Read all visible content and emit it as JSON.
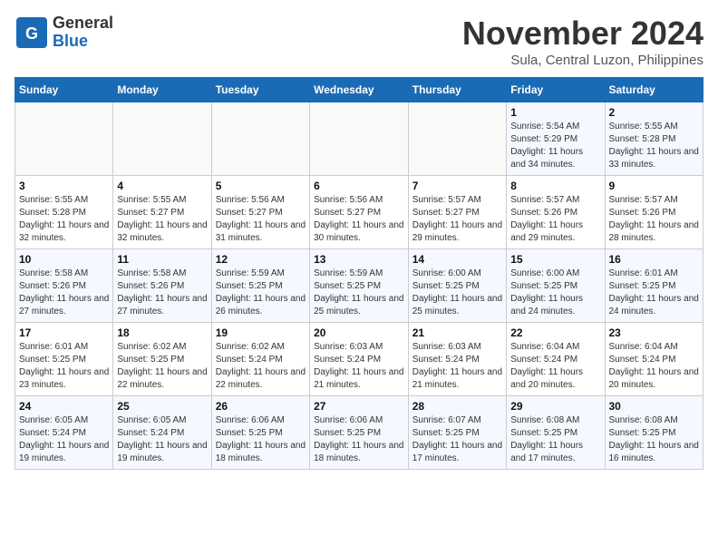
{
  "header": {
    "logo_line1": "General",
    "logo_line2": "Blue",
    "month": "November 2024",
    "location": "Sula, Central Luzon, Philippines"
  },
  "weekdays": [
    "Sunday",
    "Monday",
    "Tuesday",
    "Wednesday",
    "Thursday",
    "Friday",
    "Saturday"
  ],
  "weeks": [
    [
      {
        "day": "",
        "info": ""
      },
      {
        "day": "",
        "info": ""
      },
      {
        "day": "",
        "info": ""
      },
      {
        "day": "",
        "info": ""
      },
      {
        "day": "",
        "info": ""
      },
      {
        "day": "1",
        "info": "Sunrise: 5:54 AM\nSunset: 5:29 PM\nDaylight: 11 hours and 34 minutes."
      },
      {
        "day": "2",
        "info": "Sunrise: 5:55 AM\nSunset: 5:28 PM\nDaylight: 11 hours and 33 minutes."
      }
    ],
    [
      {
        "day": "3",
        "info": "Sunrise: 5:55 AM\nSunset: 5:28 PM\nDaylight: 11 hours and 32 minutes."
      },
      {
        "day": "4",
        "info": "Sunrise: 5:55 AM\nSunset: 5:27 PM\nDaylight: 11 hours and 32 minutes."
      },
      {
        "day": "5",
        "info": "Sunrise: 5:56 AM\nSunset: 5:27 PM\nDaylight: 11 hours and 31 minutes."
      },
      {
        "day": "6",
        "info": "Sunrise: 5:56 AM\nSunset: 5:27 PM\nDaylight: 11 hours and 30 minutes."
      },
      {
        "day": "7",
        "info": "Sunrise: 5:57 AM\nSunset: 5:27 PM\nDaylight: 11 hours and 29 minutes."
      },
      {
        "day": "8",
        "info": "Sunrise: 5:57 AM\nSunset: 5:26 PM\nDaylight: 11 hours and 29 minutes."
      },
      {
        "day": "9",
        "info": "Sunrise: 5:57 AM\nSunset: 5:26 PM\nDaylight: 11 hours and 28 minutes."
      }
    ],
    [
      {
        "day": "10",
        "info": "Sunrise: 5:58 AM\nSunset: 5:26 PM\nDaylight: 11 hours and 27 minutes."
      },
      {
        "day": "11",
        "info": "Sunrise: 5:58 AM\nSunset: 5:26 PM\nDaylight: 11 hours and 27 minutes."
      },
      {
        "day": "12",
        "info": "Sunrise: 5:59 AM\nSunset: 5:25 PM\nDaylight: 11 hours and 26 minutes."
      },
      {
        "day": "13",
        "info": "Sunrise: 5:59 AM\nSunset: 5:25 PM\nDaylight: 11 hours and 25 minutes."
      },
      {
        "day": "14",
        "info": "Sunrise: 6:00 AM\nSunset: 5:25 PM\nDaylight: 11 hours and 25 minutes."
      },
      {
        "day": "15",
        "info": "Sunrise: 6:00 AM\nSunset: 5:25 PM\nDaylight: 11 hours and 24 minutes."
      },
      {
        "day": "16",
        "info": "Sunrise: 6:01 AM\nSunset: 5:25 PM\nDaylight: 11 hours and 24 minutes."
      }
    ],
    [
      {
        "day": "17",
        "info": "Sunrise: 6:01 AM\nSunset: 5:25 PM\nDaylight: 11 hours and 23 minutes."
      },
      {
        "day": "18",
        "info": "Sunrise: 6:02 AM\nSunset: 5:25 PM\nDaylight: 11 hours and 22 minutes."
      },
      {
        "day": "19",
        "info": "Sunrise: 6:02 AM\nSunset: 5:24 PM\nDaylight: 11 hours and 22 minutes."
      },
      {
        "day": "20",
        "info": "Sunrise: 6:03 AM\nSunset: 5:24 PM\nDaylight: 11 hours and 21 minutes."
      },
      {
        "day": "21",
        "info": "Sunrise: 6:03 AM\nSunset: 5:24 PM\nDaylight: 11 hours and 21 minutes."
      },
      {
        "day": "22",
        "info": "Sunrise: 6:04 AM\nSunset: 5:24 PM\nDaylight: 11 hours and 20 minutes."
      },
      {
        "day": "23",
        "info": "Sunrise: 6:04 AM\nSunset: 5:24 PM\nDaylight: 11 hours and 20 minutes."
      }
    ],
    [
      {
        "day": "24",
        "info": "Sunrise: 6:05 AM\nSunset: 5:24 PM\nDaylight: 11 hours and 19 minutes."
      },
      {
        "day": "25",
        "info": "Sunrise: 6:05 AM\nSunset: 5:24 PM\nDaylight: 11 hours and 19 minutes."
      },
      {
        "day": "26",
        "info": "Sunrise: 6:06 AM\nSunset: 5:25 PM\nDaylight: 11 hours and 18 minutes."
      },
      {
        "day": "27",
        "info": "Sunrise: 6:06 AM\nSunset: 5:25 PM\nDaylight: 11 hours and 18 minutes."
      },
      {
        "day": "28",
        "info": "Sunrise: 6:07 AM\nSunset: 5:25 PM\nDaylight: 11 hours and 17 minutes."
      },
      {
        "day": "29",
        "info": "Sunrise: 6:08 AM\nSunset: 5:25 PM\nDaylight: 11 hours and 17 minutes."
      },
      {
        "day": "30",
        "info": "Sunrise: 6:08 AM\nSunset: 5:25 PM\nDaylight: 11 hours and 16 minutes."
      }
    ]
  ]
}
